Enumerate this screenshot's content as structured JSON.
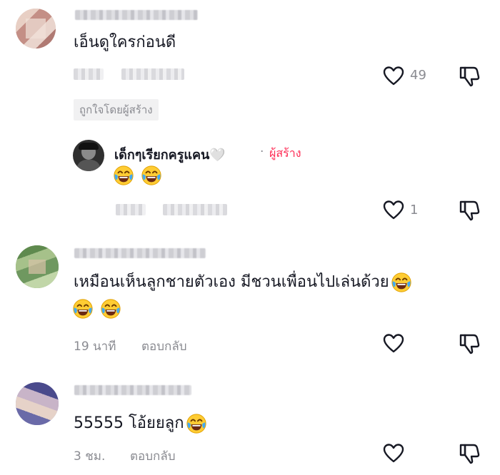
{
  "comments": [
    {
      "avatar_icon": "blurred-avatar-icon",
      "text": "เอ็นดูใครก่อนดี",
      "likes": "49",
      "creator_liked_badge": "ถูกใจโดยผู้สร้าง",
      "reply": {
        "username": "เด็กๆเรียกครูแคน🤍",
        "separator": "·",
        "creator_tag": "ผู้สร้าง",
        "likes": "1"
      }
    },
    {
      "avatar_icon": "blurred-avatar-icon",
      "text_line1": "เหมือนเห็นลูกชายตัวเอง มีชวนเพื่อนไปเล่นด้วย",
      "time": "19 นาที",
      "reply_label": "ตอบกลับ"
    },
    {
      "avatar_icon": "blurred-avatar-icon",
      "text": "55555 โอ้ยยลูก",
      "time": "3 ชม.",
      "reply_label": "ตอบกลับ"
    }
  ],
  "icons": {
    "like": "heart-icon",
    "dislike": "thumbs-down-icon",
    "emoji": "tears-of-joy-emoji-icon"
  },
  "colors": {
    "creator_tag": "#fe2c55",
    "meta": "#8a8b91"
  }
}
